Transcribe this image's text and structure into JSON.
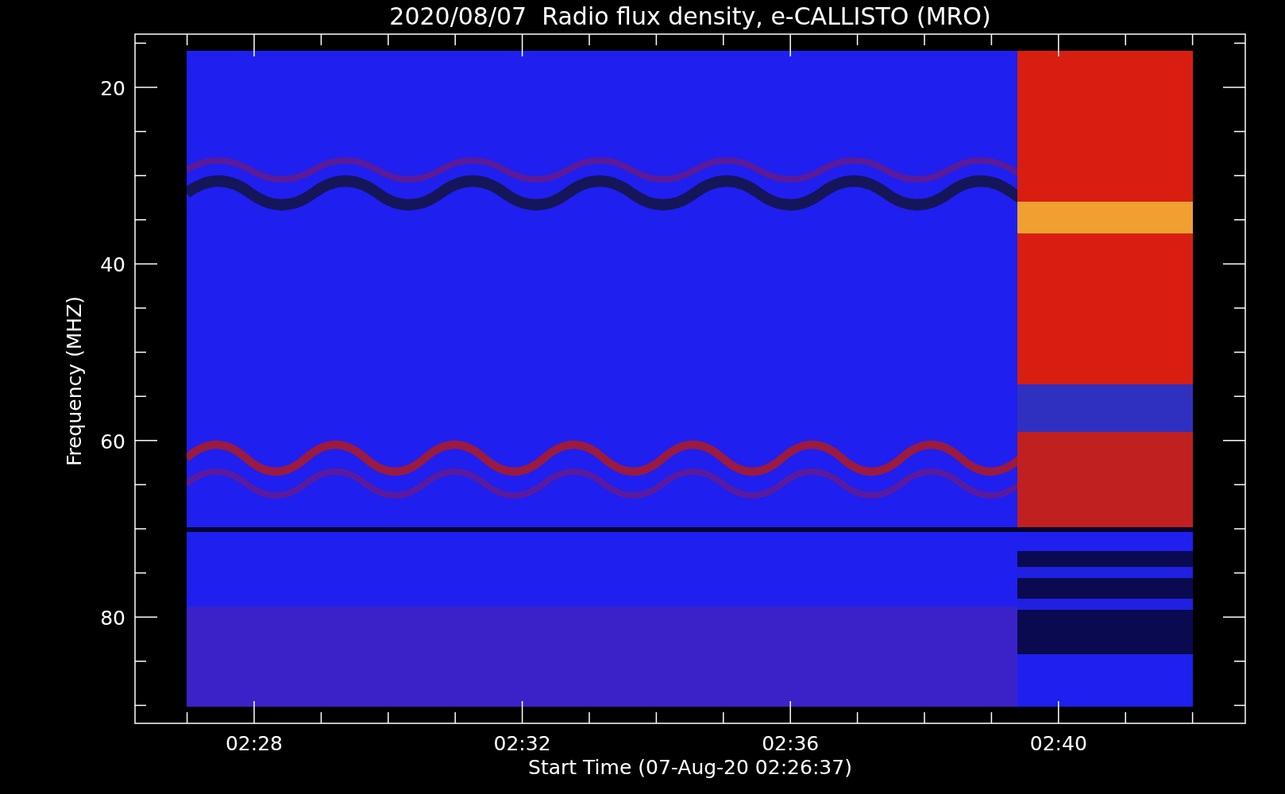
{
  "title": "2020/08/07  Radio flux density, e-CALLISTO (MRO)",
  "plot": {
    "ylabel": "Frequency (MHZ)",
    "xlabel": "Start Time (07-Aug-20 02:26:37)",
    "yticks": [
      "20",
      "40",
      "60",
      "80"
    ],
    "xticks": [
      "02:28",
      "02:32",
      "02:36",
      "02:40"
    ]
  }
}
